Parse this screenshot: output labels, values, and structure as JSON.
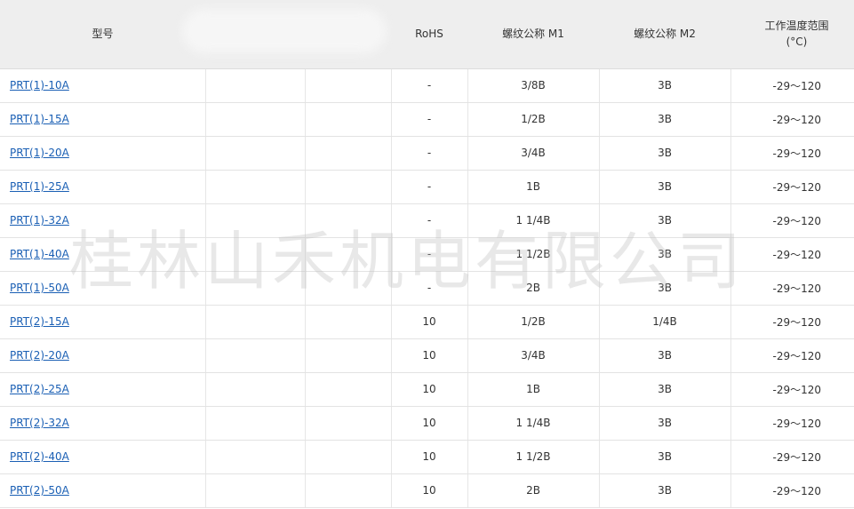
{
  "table": {
    "headers": {
      "model": "型号",
      "rohs": "RoHS",
      "m1": "螺纹公称 M1",
      "m2": "螺纹公称 M2",
      "temp_line1": "工作温度范围",
      "temp_line2": "(°C)"
    },
    "rows": [
      {
        "model": "PRT(1)-10A",
        "rohs": "-",
        "m1": "3/8B",
        "m2": "3B",
        "temp": "-29～120"
      },
      {
        "model": "PRT(1)-15A",
        "rohs": "-",
        "m1": "1/2B",
        "m2": "3B",
        "temp": "-29～120"
      },
      {
        "model": "PRT(1)-20A",
        "rohs": "-",
        "m1": "3/4B",
        "m2": "3B",
        "temp": "-29～120"
      },
      {
        "model": "PRT(1)-25A",
        "rohs": "-",
        "m1": "1B",
        "m2": "3B",
        "temp": "-29～120"
      },
      {
        "model": "PRT(1)-32A",
        "rohs": "-",
        "m1": "1 1/4B",
        "m2": "3B",
        "temp": "-29～120"
      },
      {
        "model": "PRT(1)-40A",
        "rohs": "-",
        "m1": "1 1/2B",
        "m2": "3B",
        "temp": "-29～120"
      },
      {
        "model": "PRT(1)-50A",
        "rohs": "-",
        "m1": "2B",
        "m2": "3B",
        "temp": "-29～120"
      },
      {
        "model": "PRT(2)-15A",
        "rohs": "10",
        "m1": "1/2B",
        "m2": "1/4B",
        "temp": "-29～120"
      },
      {
        "model": "PRT(2)-20A",
        "rohs": "10",
        "m1": "3/4B",
        "m2": "3B",
        "temp": "-29～120"
      },
      {
        "model": "PRT(2)-25A",
        "rohs": "10",
        "m1": "1B",
        "m2": "3B",
        "temp": "-29～120"
      },
      {
        "model": "PRT(2)-32A",
        "rohs": "10",
        "m1": "1 1/4B",
        "m2": "3B",
        "temp": "-29～120"
      },
      {
        "model": "PRT(2)-40A",
        "rohs": "10",
        "m1": "1 1/2B",
        "m2": "3B",
        "temp": "-29～120"
      },
      {
        "model": "PRT(2)-50A",
        "rohs": "10",
        "m1": "2B",
        "m2": "3B",
        "temp": "-29～120"
      }
    ]
  },
  "watermark": "桂林山禾机电有限公司",
  "colors": {
    "header_bg": "#eeeeee",
    "link": "#1a5fb4",
    "border": "#e3e3e3",
    "text": "#333333"
  }
}
